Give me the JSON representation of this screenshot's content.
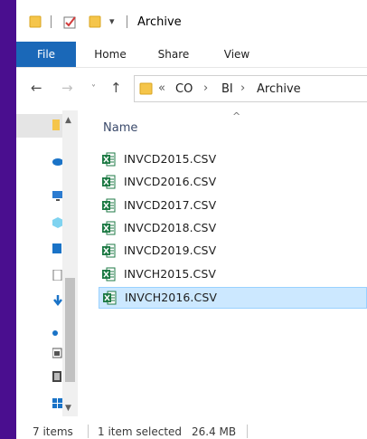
{
  "window": {
    "title": "Archive"
  },
  "ribbon": {
    "tabs": [
      "File",
      "Home",
      "Share",
      "View"
    ]
  },
  "address": {
    "overflow": "«",
    "crumbs": [
      "CO",
      "BI",
      "Archive"
    ]
  },
  "columns": {
    "name": "Name"
  },
  "files": [
    {
      "name": "INVCD2015.CSV",
      "selected": false
    },
    {
      "name": "INVCD2016.CSV",
      "selected": false
    },
    {
      "name": "INVCD2017.CSV",
      "selected": false
    },
    {
      "name": "INVCD2018.CSV",
      "selected": false
    },
    {
      "name": "INVCD2019.CSV",
      "selected": false
    },
    {
      "name": "INVCH2015.CSV",
      "selected": false
    },
    {
      "name": "INVCH2016.CSV",
      "selected": true
    }
  ],
  "status": {
    "count": "7 items",
    "selection": "1 item selected",
    "size": "26.4 MB"
  },
  "colors": {
    "accent": "#1a68b8",
    "selection_bg": "#cce8ff",
    "selection_border": "#99d1ff",
    "excel_green": "#1d7a44",
    "folder": "#f5c54a",
    "desktop_bg": "#4a0e8f"
  },
  "icons": {
    "file": "excel-csv-icon",
    "folder": "folder-icon"
  }
}
